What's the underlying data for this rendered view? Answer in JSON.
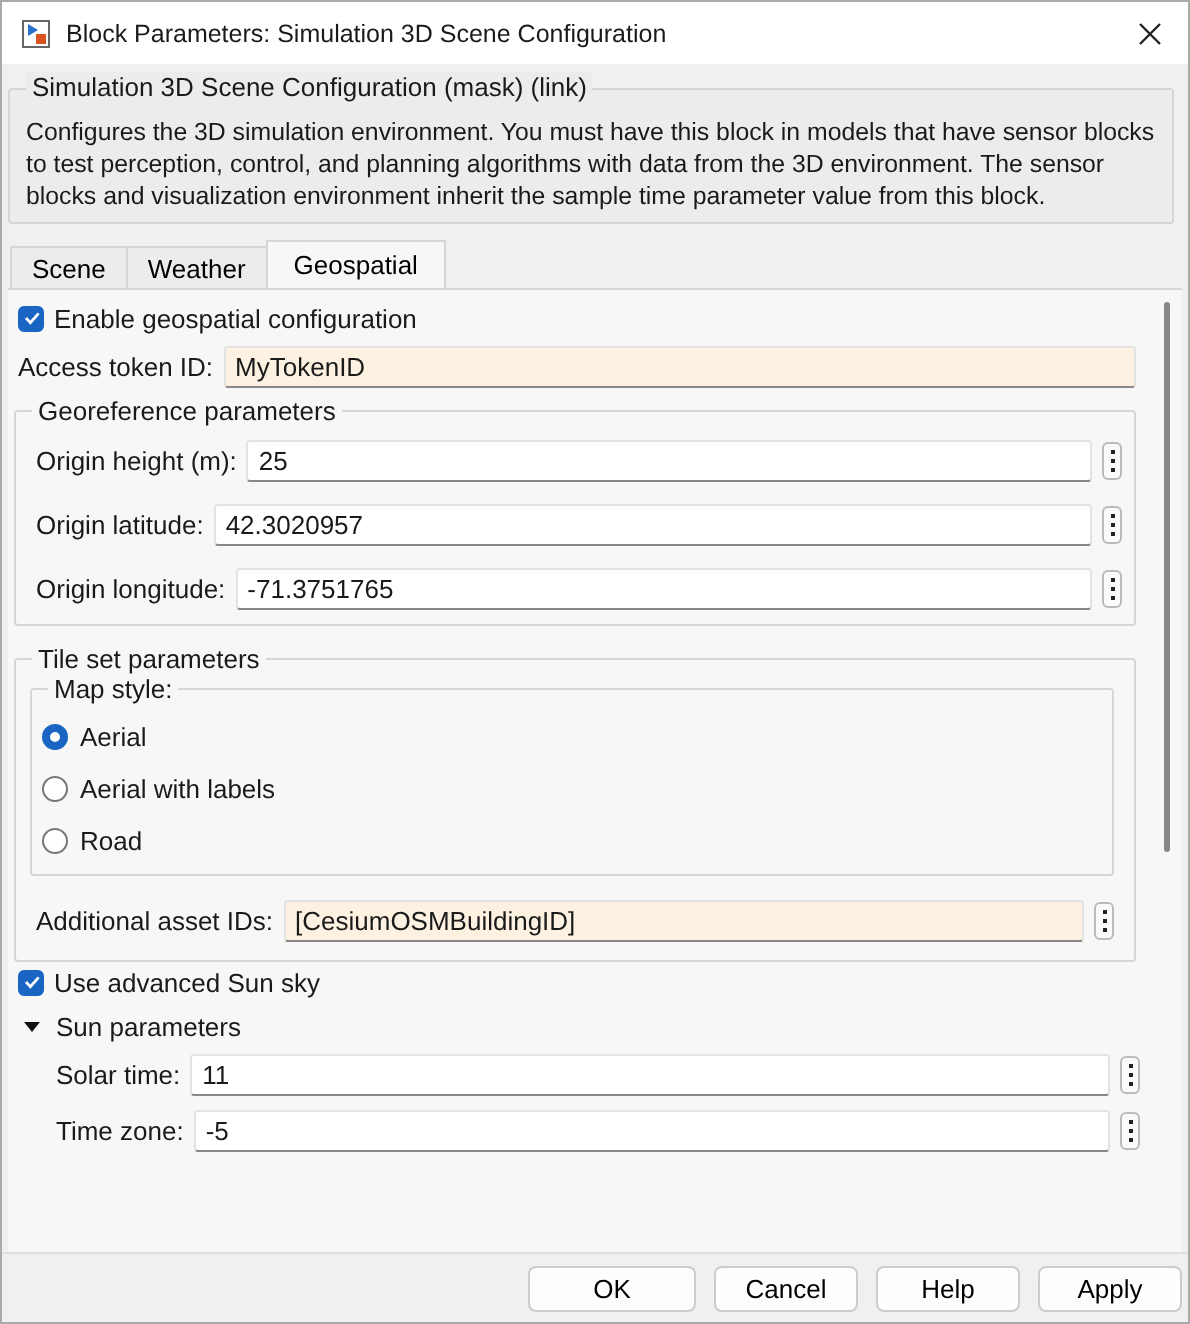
{
  "window": {
    "title": "Block Parameters: Simulation 3D Scene Configuration"
  },
  "description": {
    "title": "Simulation 3D Scene Configuration (mask) (link)",
    "text": "Configures the 3D simulation environment. You must have this block in models that have sensor blocks to test perception, control, and planning algorithms with data from the 3D environment. The sensor blocks and visualization environment inherit the sample time parameter value from this block."
  },
  "tabs": [
    {
      "label": "Scene",
      "selected": false
    },
    {
      "label": "Weather",
      "selected": false
    },
    {
      "label": "Geospatial",
      "selected": true
    }
  ],
  "enable_geospatial": {
    "label": "Enable geospatial configuration",
    "checked": true
  },
  "access_token": {
    "label": "Access token ID:",
    "value": "MyTokenID"
  },
  "georeference": {
    "title": "Georeference parameters",
    "fields": [
      {
        "label": "Origin height (m):",
        "value": "25"
      },
      {
        "label": "Origin latitude:",
        "value": "42.3020957"
      },
      {
        "label": "Origin longitude:",
        "value": "-71.3751765"
      }
    ]
  },
  "tile_set": {
    "title": "Tile set parameters",
    "map_style": {
      "title": "Map style:",
      "options": [
        {
          "label": "Aerial",
          "selected": true
        },
        {
          "label": "Aerial with labels",
          "selected": false
        },
        {
          "label": "Road",
          "selected": false
        }
      ]
    },
    "additional_assets": {
      "label": "Additional asset IDs:",
      "value": "[CesiumOSMBuildingID]"
    }
  },
  "advanced_sun": {
    "label": "Use advanced Sun sky",
    "checked": true
  },
  "sun_parameters": {
    "label": "Sun parameters",
    "expanded": true,
    "fields": [
      {
        "label": "Solar time:",
        "value": "11"
      },
      {
        "label": "Time zone:",
        "value": "-5"
      }
    ]
  },
  "buttons": [
    "OK",
    "Cancel",
    "Help",
    "Apply"
  ]
}
